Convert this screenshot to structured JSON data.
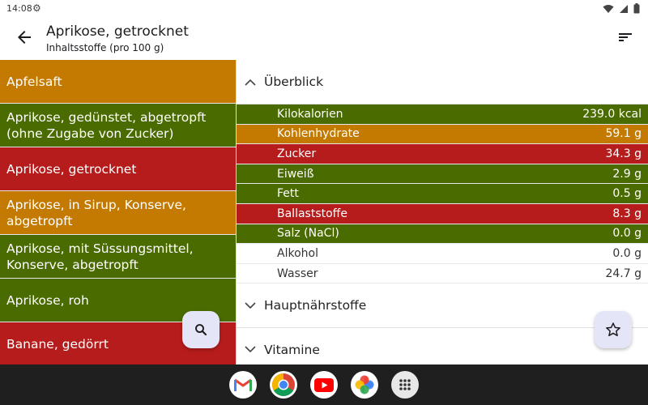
{
  "status_bar": {
    "time": "14:08"
  },
  "app_bar": {
    "title": "Aprikose, getrocknet",
    "subtitle": "Inhaltsstoffe (pro 100 g)"
  },
  "food_list": [
    {
      "label": "Apfelsaft",
      "color": "orange"
    },
    {
      "label": "Aprikose, gedünstet, abgetropft (ohne Zugabe von Zucker)",
      "color": "green"
    },
    {
      "label": "Aprikose, getrocknet",
      "color": "red"
    },
    {
      "label": "Aprikose, in Sirup, Konserve, abgetropft",
      "color": "orange"
    },
    {
      "label": "Aprikose, mit Süssungsmittel, Konserve, abgetropft",
      "color": "green"
    },
    {
      "label": "Aprikose, roh",
      "color": "green"
    },
    {
      "label": "Banane, gedörrt",
      "color": "red"
    }
  ],
  "sections": {
    "overview": "Überblick",
    "main_nutrients": "Hauptnährstoffe",
    "vitamins": "Vitamine"
  },
  "nutrients": [
    {
      "name": "Kilokalorien",
      "value": "239.0 kcal",
      "color": "green"
    },
    {
      "name": "Kohlenhydrate",
      "value": "59.1 g",
      "color": "orange"
    },
    {
      "name": "Zucker",
      "value": "34.3 g",
      "color": "red"
    },
    {
      "name": "Eiweiß",
      "value": "2.9 g",
      "color": "green"
    },
    {
      "name": "Fett",
      "value": "0.5 g",
      "color": "green"
    },
    {
      "name": "Ballaststoffe",
      "value": "8.3 g",
      "color": "red"
    },
    {
      "name": "Salz (NaCl)",
      "value": "0.0 g",
      "color": "green"
    },
    {
      "name": "Alkohol",
      "value": "0.0 g",
      "color": "none"
    },
    {
      "name": "Wasser",
      "value": "24.7 g",
      "color": "none"
    }
  ],
  "colors": {
    "orange": "#c47a00",
    "green": "#4a6b00",
    "red": "#b71c1c",
    "fab_bg": "#e4e6f7",
    "nav_bg": "#1f1f1f"
  },
  "dock_apps": [
    "gmail-icon",
    "chrome-icon",
    "youtube-icon",
    "photos-icon",
    "app-drawer-icon"
  ]
}
